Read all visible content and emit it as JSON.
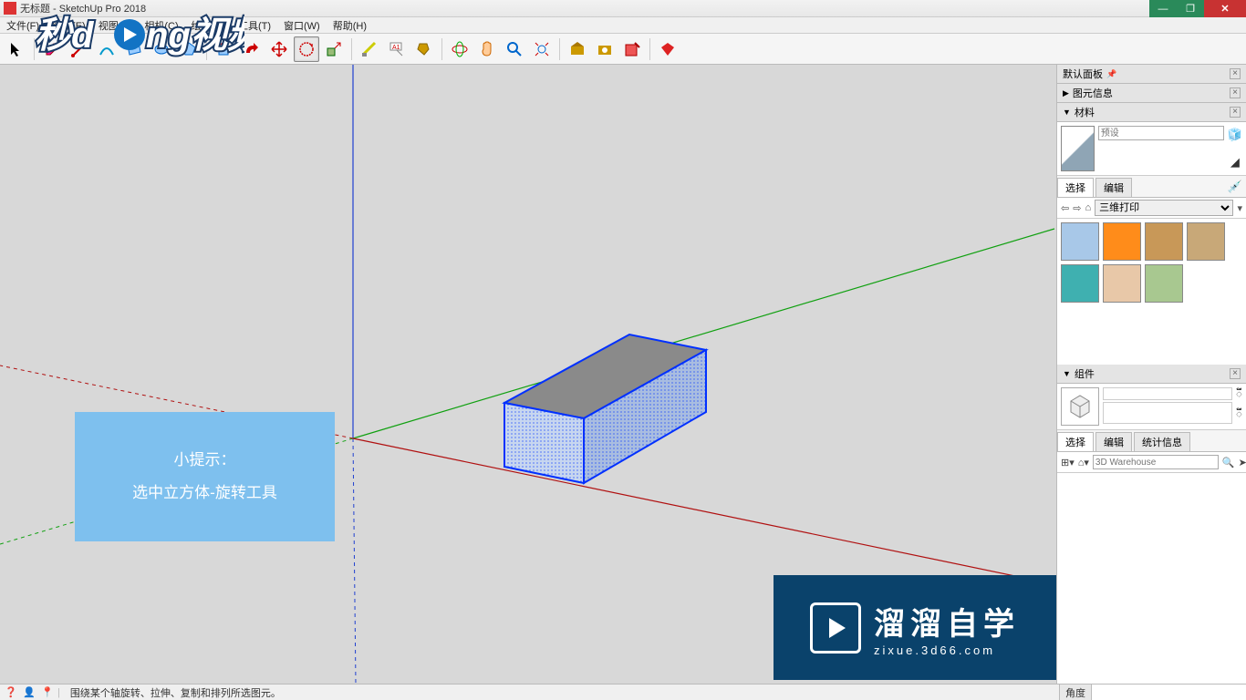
{
  "title": "无标题 - SketchUp Pro 2018",
  "menu": [
    "文件(F)",
    "编辑(E)",
    "视图(V)",
    "相机(C)",
    "绘图(R)",
    "工具(T)",
    "窗口(W)",
    "帮助(H)"
  ],
  "default_panel_title": "默认面板",
  "panel_entity_info": "图元信息",
  "panel_materials": "材料",
  "material_name_placeholder": "预设",
  "mat_tab_select": "选择",
  "mat_tab_edit": "编辑",
  "mat_category": "三维打印",
  "panel_components": "组件",
  "comp_tab_select": "选择",
  "comp_tab_edit": "编辑",
  "comp_tab_stats": "统计信息",
  "comp_search_placeholder": "3D Warehouse",
  "hint_title": "小提示：",
  "hint_body": "选中立方体-旋转工具",
  "status_text": "围绕某个轴旋转、拉伸、复制和排列所选图元。",
  "status_angle_label": "角度",
  "watermark_top": "秒dong视频",
  "watermark_big": "溜溜自学",
  "watermark_small": "zixue.3d66.com",
  "material_swatches": [
    "#a8c8e8",
    "#ff8c1a",
    "#c89858",
    "#c8a878",
    "#3fb0b0",
    "#e8c8a8",
    "#a8c890"
  ]
}
